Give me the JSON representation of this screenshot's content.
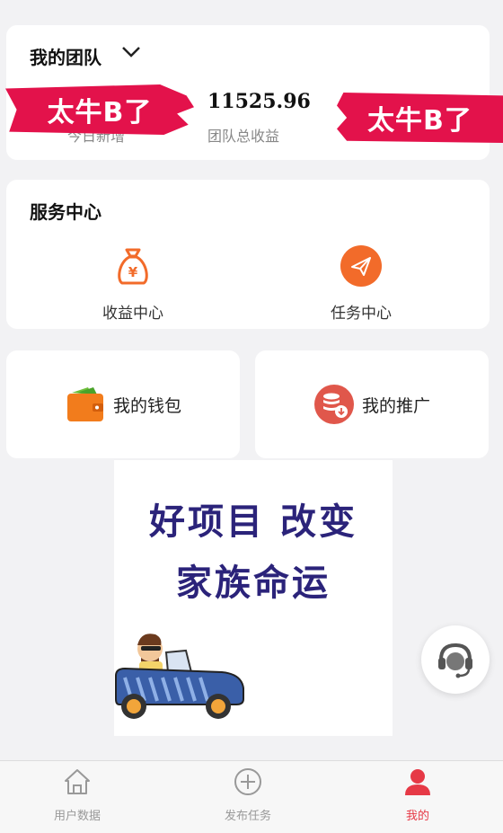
{
  "team": {
    "title": "我的团队",
    "today_value": "",
    "today_label": "今日新增",
    "total_value": "11525.96",
    "total_label": "团队总收益"
  },
  "overlay_banner": {
    "text": "太牛B了",
    "color": "#e3124b"
  },
  "service": {
    "title": "服务中心",
    "items": [
      {
        "label": "收益中心",
        "icon": "money-bag-icon"
      },
      {
        "label": "任务中心",
        "icon": "paper-plane-icon"
      }
    ]
  },
  "wallet": {
    "label": "我的钱包",
    "icon": "wallet-icon"
  },
  "promotion": {
    "label": "我的推广",
    "icon": "coin-stack-icon"
  },
  "poster": {
    "line1": "好项目 改变",
    "line2": "家族命运"
  },
  "tabbar": {
    "items": [
      {
        "label": "用户数据",
        "icon": "home-icon",
        "active": false
      },
      {
        "label": "发布任务",
        "icon": "plus-circle-icon",
        "active": false
      },
      {
        "label": "我的",
        "icon": "user-icon",
        "active": true
      }
    ]
  },
  "colors": {
    "accent": "#e63946",
    "orange": "#f26b2a",
    "poster_text": "#2b237a"
  }
}
